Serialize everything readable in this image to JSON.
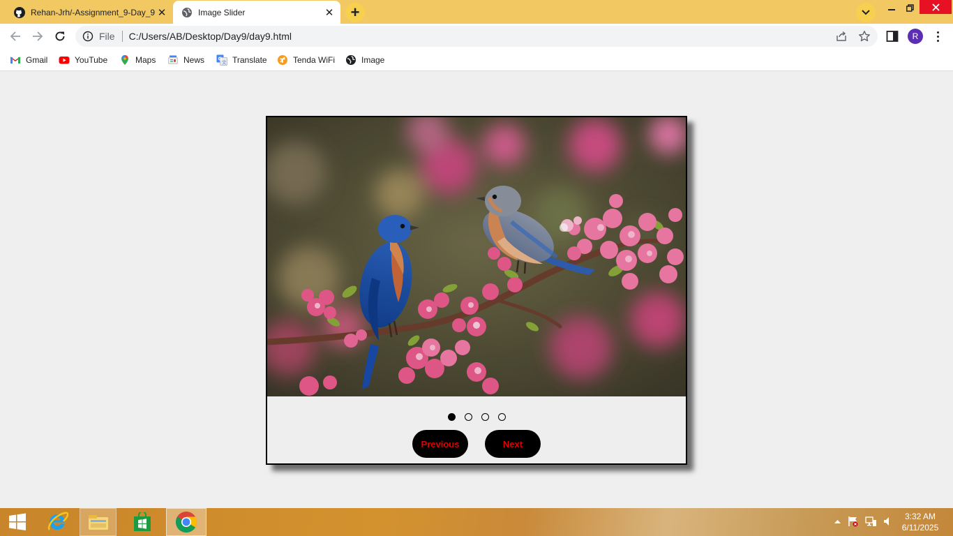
{
  "browser": {
    "tabs": [
      {
        "title": "Rehan-Jrh/-Assignment_9-Day_9",
        "icon": "github-icon",
        "active": false
      },
      {
        "title": "Image Slider",
        "icon": "globe-icon",
        "active": true
      }
    ],
    "address": {
      "scheme_label": "File",
      "url": "C:/Users/AB/Desktop/Day9/day9.html"
    },
    "profile_initial": "R",
    "bookmarks": [
      {
        "label": "Gmail",
        "icon": "gmail-icon"
      },
      {
        "label": "YouTube",
        "icon": "youtube-icon"
      },
      {
        "label": "Maps",
        "icon": "maps-pin-icon"
      },
      {
        "label": "News",
        "icon": "google-news-icon"
      },
      {
        "label": "Translate",
        "icon": "translate-icon"
      },
      {
        "label": "Tenda WiFi",
        "icon": "tenda-icon"
      },
      {
        "label": "Image",
        "icon": "globe-icon"
      }
    ],
    "colors": {
      "tab_strip": "#f2c862",
      "avatar": "#5b2eb3"
    }
  },
  "slider": {
    "image_subject": "two bluebirds on a blossoming branch",
    "slide_count": 4,
    "active_index": 0,
    "prev_label": "Previous",
    "next_label": "Next",
    "button_text_color": "#e00000"
  },
  "taskbar": {
    "apps": [
      "windows-start-icon",
      "internet-explorer-icon",
      "file-explorer-icon",
      "store-icon",
      "chrome-icon"
    ],
    "time": "3:32 AM",
    "date": "6/11/2025"
  }
}
